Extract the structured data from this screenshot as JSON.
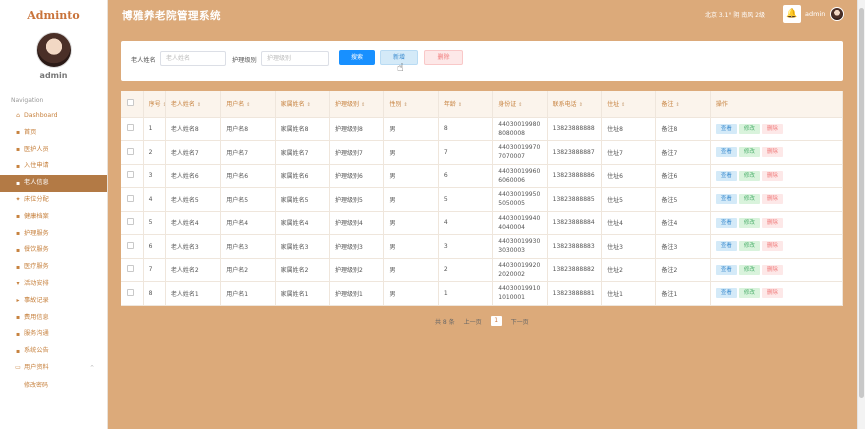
{
  "sidebar": {
    "brand": "Adminto",
    "username": "admin",
    "nav_title": "Navigation",
    "items": [
      {
        "label": "Dashboard",
        "icon": "home-icon",
        "glyph": "⌂"
      },
      {
        "label": "首页",
        "icon": "grid-icon",
        "glyph": "▪"
      },
      {
        "label": "医护人员",
        "icon": "grid-icon",
        "glyph": "▪"
      },
      {
        "label": "入住申请",
        "icon": "user-icon",
        "glyph": "▪"
      },
      {
        "label": "老人信息",
        "icon": "folder-icon",
        "glyph": "▪"
      },
      {
        "label": "床位分配",
        "icon": "gear-icon",
        "glyph": "✦"
      },
      {
        "label": "健康档案",
        "icon": "grid-icon",
        "glyph": "▪"
      },
      {
        "label": "护理服务",
        "icon": "grid-icon",
        "glyph": "▪"
      },
      {
        "label": "餐饮服务",
        "icon": "grid-icon",
        "glyph": "▪"
      },
      {
        "label": "医疗服务",
        "icon": "grid-icon",
        "glyph": "▪"
      },
      {
        "label": "活动安排",
        "icon": "pin-icon",
        "glyph": "▾"
      },
      {
        "label": "事故记录",
        "icon": "flag-icon",
        "glyph": "▸"
      },
      {
        "label": "费用信息",
        "icon": "grid-icon",
        "glyph": "▪"
      },
      {
        "label": "服务沟通",
        "icon": "briefcase-icon",
        "glyph": "▪"
      },
      {
        "label": "系统公告",
        "icon": "grid-icon",
        "glyph": "▪"
      },
      {
        "label": "用户资料",
        "icon": "window-icon",
        "glyph": "▭"
      }
    ],
    "sub_item": "修改密码",
    "active_index": 4
  },
  "header": {
    "title": "博雅养老院管理系统",
    "weather": "北京  3.1°  阴  南风  2级",
    "user": "admin"
  },
  "search": {
    "name_label": "老人姓名",
    "name_placeholder": "老人姓名",
    "level_label": "护理级别",
    "level_placeholder": "护理级别",
    "search_btn": "搜索",
    "add_btn": "新增",
    "delete_btn": "删除"
  },
  "table": {
    "headers": [
      "序号",
      "老人姓名",
      "用户名",
      "家属姓名",
      "护理级别",
      "性别",
      "年龄",
      "身份证",
      "联系电话",
      "住址",
      "备注",
      "操作"
    ],
    "actions": {
      "view": "查看",
      "edit": "修改",
      "delete": "删除"
    },
    "rows": [
      {
        "no": "1",
        "name": "老人姓名8",
        "username": "用户名8",
        "family": "家属姓名8",
        "level": "护理级别8",
        "gender": "男",
        "age": "8",
        "id_card": "440300199808080008",
        "phone": "13823888888",
        "address": "住址8",
        "remark": "备注8"
      },
      {
        "no": "2",
        "name": "老人姓名7",
        "username": "用户名7",
        "family": "家属姓名7",
        "level": "护理级别7",
        "gender": "男",
        "age": "7",
        "id_card": "440300199707070007",
        "phone": "13823888887",
        "address": "住址7",
        "remark": "备注7"
      },
      {
        "no": "3",
        "name": "老人姓名6",
        "username": "用户名6",
        "family": "家属姓名6",
        "level": "护理级别6",
        "gender": "男",
        "age": "6",
        "id_card": "440300199606060006",
        "phone": "13823888886",
        "address": "住址6",
        "remark": "备注6"
      },
      {
        "no": "4",
        "name": "老人姓名5",
        "username": "用户名5",
        "family": "家属姓名5",
        "level": "护理级别5",
        "gender": "男",
        "age": "5",
        "id_card": "440300199505050005",
        "phone": "13823888885",
        "address": "住址5",
        "remark": "备注5"
      },
      {
        "no": "5",
        "name": "老人姓名4",
        "username": "用户名4",
        "family": "家属姓名4",
        "level": "护理级别4",
        "gender": "男",
        "age": "4",
        "id_card": "440300199404040004",
        "phone": "13823888884",
        "address": "住址4",
        "remark": "备注4"
      },
      {
        "no": "6",
        "name": "老人姓名3",
        "username": "用户名3",
        "family": "家属姓名3",
        "level": "护理级别3",
        "gender": "男",
        "age": "3",
        "id_card": "440300199303030003",
        "phone": "13823888883",
        "address": "住址3",
        "remark": "备注3"
      },
      {
        "no": "7",
        "name": "老人姓名2",
        "username": "用户名2",
        "family": "家属姓名2",
        "level": "护理级别2",
        "gender": "男",
        "age": "2",
        "id_card": "440300199202020002",
        "phone": "13823888882",
        "address": "住址2",
        "remark": "备注2"
      },
      {
        "no": "8",
        "name": "老人姓名1",
        "username": "用户名1",
        "family": "家属姓名1",
        "level": "护理级别1",
        "gender": "男",
        "age": "1",
        "id_card": "440300199101010001",
        "phone": "13823888881",
        "address": "住址1",
        "remark": "备注1"
      }
    ]
  },
  "pager": {
    "total": "共 8 条",
    "prev": "上一页",
    "page": "1",
    "next": "下一页"
  },
  "colors": {
    "accent": "#dcaa7a",
    "active_nav": "#b37a45",
    "primary": "#1890ff"
  }
}
